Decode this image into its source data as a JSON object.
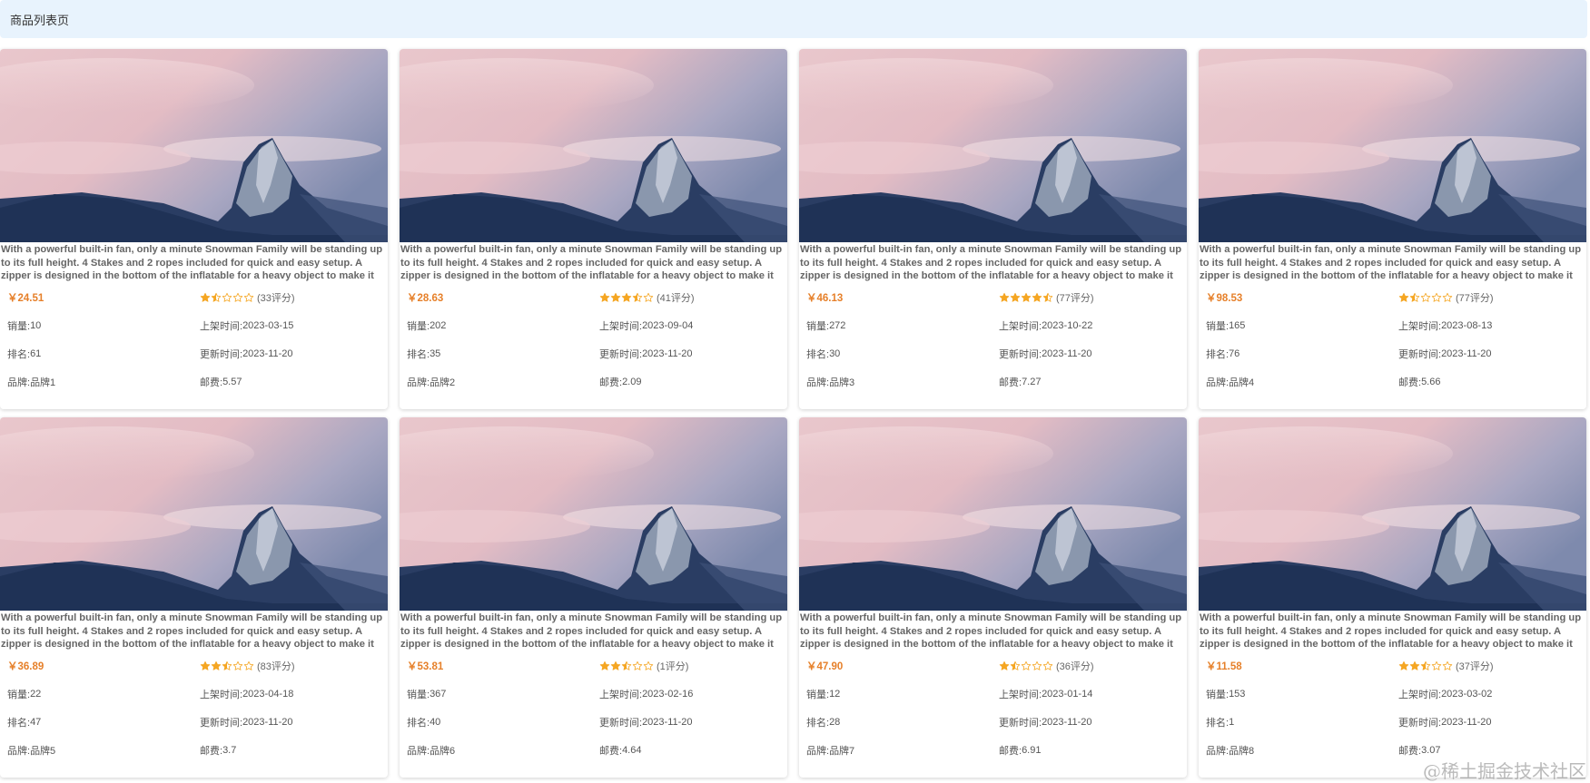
{
  "header": {
    "title": "商品列表页"
  },
  "description": "With a powerful built-in fan, only a minute Snowman Family will be standing up to its full height. 4 Stakes and 2 ropes included for quick and easy setup. A zipper is designed in the bottom of the inflatable for a heavy object to make it more stable",
  "labels": {
    "sales": "销量: ",
    "listed": "上架时间: ",
    "rank": "排名: ",
    "updated": "更新时间: ",
    "brand": "品牌: ",
    "shipping": "邮费: "
  },
  "colors": {
    "price": "#e6802a",
    "star": "#f5a623",
    "header_bg": "#e8f3fd"
  },
  "products": [
    {
      "price": "￥24.51",
      "rating": 1.5,
      "rating_text": "(33评分)",
      "sales": "10",
      "listed": "2023-03-15",
      "rank": "61",
      "updated": "2023-11-20",
      "brand": "品牌1",
      "shipping": "5.57"
    },
    {
      "price": "￥28.63",
      "rating": 3.5,
      "rating_text": "(41评分)",
      "sales": "202",
      "listed": "2023-09-04",
      "rank": "35",
      "updated": "2023-11-20",
      "brand": "品牌2",
      "shipping": "2.09"
    },
    {
      "price": "￥46.13",
      "rating": 4.5,
      "rating_text": "(77评分)",
      "sales": "272",
      "listed": "2023-10-22",
      "rank": "30",
      "updated": "2023-11-20",
      "brand": "品牌3",
      "shipping": "7.27"
    },
    {
      "price": "￥98.53",
      "rating": 1.5,
      "rating_text": "(77评分)",
      "sales": "165",
      "listed": "2023-08-13",
      "rank": "76",
      "updated": "2023-11-20",
      "brand": "品牌4",
      "shipping": "5.66"
    },
    {
      "price": "￥36.89",
      "rating": 2.5,
      "rating_text": "(83评分)",
      "sales": "22",
      "listed": "2023-04-18",
      "rank": "47",
      "updated": "2023-11-20",
      "brand": "品牌5",
      "shipping": "3.7"
    },
    {
      "price": "￥53.81",
      "rating": 2.5,
      "rating_text": "(1评分)",
      "sales": "367",
      "listed": "2023-02-16",
      "rank": "40",
      "updated": "2023-11-20",
      "brand": "品牌6",
      "shipping": "4.64"
    },
    {
      "price": "￥47.90",
      "rating": 1.5,
      "rating_text": "(36评分)",
      "sales": "12",
      "listed": "2023-01-14",
      "rank": "28",
      "updated": "2023-11-20",
      "brand": "品牌7",
      "shipping": "6.91"
    },
    {
      "price": "￥11.58",
      "rating": 2.5,
      "rating_text": "(37评分)",
      "sales": "153",
      "listed": "2023-03-02",
      "rank": "1",
      "updated": "2023-11-20",
      "brand": "品牌8",
      "shipping": "3.07"
    }
  ],
  "watermark": "@稀土掘金技术社区"
}
